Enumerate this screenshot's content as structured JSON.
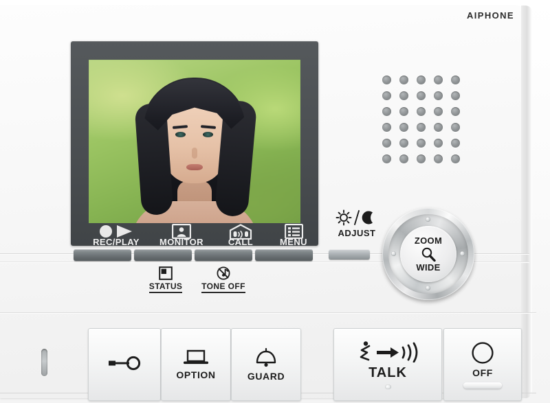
{
  "device": {
    "brand": "AIPHONE",
    "type": "video-intercom-master-station",
    "accent_dark": "#4a4e51",
    "body_color": "#f7f7f7",
    "label_color": "#1d1d1d"
  },
  "screen": {
    "name": "lcd-display",
    "content_description": "live video feed of a woman with long dark hair outdoors against blurred green foliage"
  },
  "bezel_buttons": [
    {
      "label": "REC/PLAY",
      "icon": "record-play-icon"
    },
    {
      "label": "MONITOR",
      "icon": "monitor-icon"
    },
    {
      "label": "CALL",
      "icon": "call-icon"
    },
    {
      "label": "MENU",
      "icon": "menu-list-icon"
    }
  ],
  "adjust": {
    "label": "ADJUST",
    "icon": "sun-moon-icon",
    "key_name": "adjust-key"
  },
  "dial": {
    "top_label": "ZOOM",
    "bottom_label": "WIDE",
    "icon": "magnifier-icon",
    "screw_count": 4
  },
  "indicators": [
    {
      "label": "STATUS",
      "icon": "status-square-icon"
    },
    {
      "label": "TONE OFF",
      "icon": "tone-off-icon"
    }
  ],
  "speaker": {
    "name": "speaker-grille",
    "columns": 5,
    "rows": 6
  },
  "microphone": {
    "name": "microphone-slot"
  },
  "bottom_buttons": [
    {
      "label": "",
      "icon": "door-release-key-icon",
      "name": "door-release-button"
    },
    {
      "label": "OPTION",
      "icon": "option-device-icon",
      "name": "option-button"
    },
    {
      "label": "GUARD",
      "icon": "guard-bell-icon",
      "name": "guard-button"
    },
    {
      "label": "TALK",
      "icon": "talk-speak-icon",
      "name": "talk-button"
    },
    {
      "label": "OFF",
      "icon": "off-circle-icon",
      "name": "off-button"
    }
  ]
}
